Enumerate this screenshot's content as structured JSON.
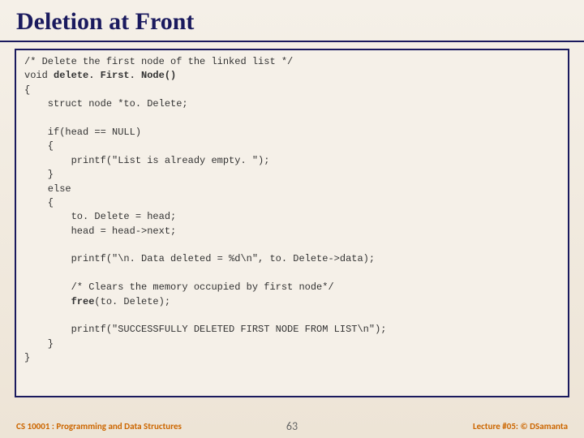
{
  "title": "Deletion at Front",
  "code": {
    "l1": "/* Delete the first node of the linked list */",
    "l2a": "void ",
    "l2b": "delete. First. Node()",
    "l3": "{",
    "l4": "    struct node *to. Delete;",
    "l5": "",
    "l6": "    if(head == NULL)",
    "l7": "    {",
    "l8": "        printf(\"List is already empty. \");",
    "l9": "    }",
    "l10": "    else",
    "l11": "    {",
    "l12": "        to. Delete = head;",
    "l13": "        head = head->next;",
    "l14": "",
    "l15": "        printf(\"\\n. Data deleted = %d\\n\", to. Delete->data);",
    "l16": "",
    "l17": "        /* Clears the memory occupied by first node*/",
    "l18a": "        ",
    "l18b": "free",
    "l18c": "(to. Delete);",
    "l19": "",
    "l20": "        printf(\"SUCCESSFULLY DELETED FIRST NODE FROM LIST\\n\");",
    "l21": "    }",
    "l22": "}"
  },
  "footer": {
    "left": "CS 10001 : Programming and Data Structures",
    "center": "63",
    "right": "Lecture #05: © DSamanta"
  }
}
